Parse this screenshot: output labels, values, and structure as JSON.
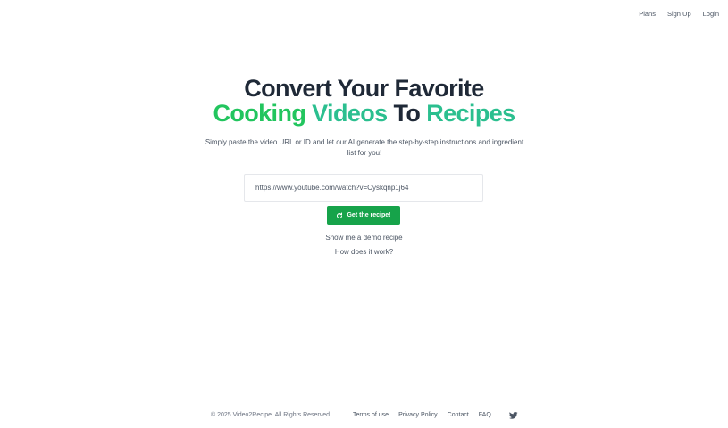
{
  "nav": {
    "plans": "Plans",
    "signup": "Sign Up",
    "login": "Login"
  },
  "hero": {
    "line1": "Convert Your Favorite",
    "line2_part1": "Cooking",
    "line2_part2": "Videos",
    "line2_part3": "To",
    "line2_part4": "Recipes",
    "subtitle": "Simply paste the video URL or ID and let our AI generate the step-by-step instructions and ingredient list for you!"
  },
  "form": {
    "url_value": "https://www.youtube.com/watch?v=Cyskqnp1j64",
    "submit_label": "Get the recipe!",
    "submit_icon": "refresh-icon"
  },
  "links": {
    "demo": "Show me a demo recipe",
    "how": "How does it work?"
  },
  "footer": {
    "copyright": "© 2025 Video2Recipe. All Rights Reserved.",
    "terms": "Terms of use",
    "privacy": "Privacy Policy",
    "contact": "Contact",
    "faq": "FAQ",
    "social_icon": "twitter-icon"
  },
  "colors": {
    "brand_green": "#16a34a",
    "heading_green": "#22c55e",
    "heading_teal": "#2bbf8f",
    "heading_dark": "#1f2937"
  }
}
